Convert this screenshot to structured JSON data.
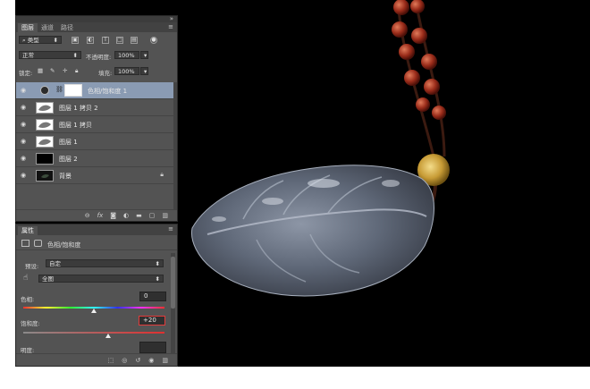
{
  "layers_panel": {
    "tabs": [
      "图层",
      "通道",
      "路径"
    ],
    "kind_filter": "类型",
    "blend_mode": "正常",
    "opacity_label": "不透明度:",
    "opacity_value": "100%",
    "lock_label": "锁定:",
    "fill_label": "填充:",
    "fill_value": "100%",
    "layers": [
      {
        "name": "色相/饱和度 1",
        "selected": true,
        "icon": "adjustment-layer-icon"
      },
      {
        "name": "图层 1 拷贝 2",
        "selected": false,
        "icon": "layer-thumbnail"
      },
      {
        "name": "图层 1 拷贝",
        "selected": false,
        "icon": "layer-thumbnail"
      },
      {
        "name": "图层 1",
        "selected": false,
        "icon": "layer-thumbnail"
      },
      {
        "name": "图层 2",
        "selected": false,
        "icon": "layer-thumbnail"
      },
      {
        "name": "背景",
        "selected": false,
        "icon": "layer-thumbnail",
        "locked": true
      }
    ],
    "bottom_icons": [
      "link-icon",
      "fx-icon",
      "mask-icon",
      "adjustment-icon",
      "folder-icon",
      "new-layer-icon",
      "trash-icon"
    ]
  },
  "properties_panel": {
    "tab": "属性",
    "title": "色相/饱和度",
    "preset_label": "预设:",
    "preset_value": "自定",
    "channel_value": "全图",
    "hue_label": "色相:",
    "hue_value": "0",
    "saturation_label": "饱和度:",
    "saturation_value": "+20",
    "lightness_label": "明度:",
    "saturation_level": 0.6,
    "hue_level": 0.5,
    "bottom_icons": [
      "clip-icon",
      "view-previous-icon",
      "reset-icon",
      "visibility-icon",
      "trash-icon"
    ]
  },
  "colors": {
    "panel_bg": "#535353",
    "selected_layer": "#8a9bb3",
    "highlight_border": "#e23b3b",
    "canvas_bg": "#000000"
  }
}
